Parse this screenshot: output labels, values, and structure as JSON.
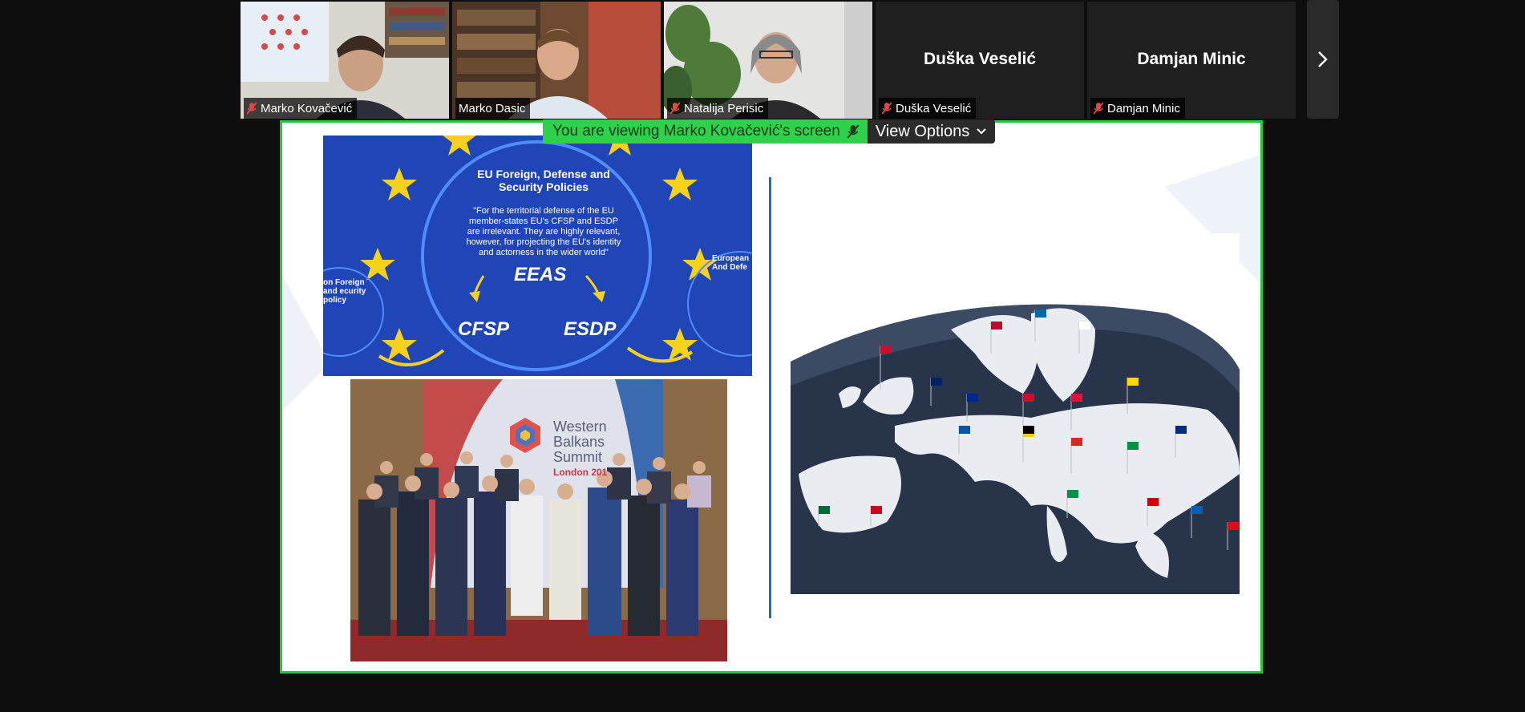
{
  "participants": [
    {
      "name": "Marko Kovačević",
      "muted": true
    },
    {
      "name": "Marko Dasic",
      "muted": false
    },
    {
      "name": "Natalija Perisic",
      "muted": true
    },
    {
      "name": "Duška Veselić",
      "muted": true
    },
    {
      "name": "Damjan Minic",
      "muted": true
    }
  ],
  "banner": {
    "viewing_text": "You are viewing Marko Kovačević's screen",
    "options_label": "View Options"
  },
  "slide": {
    "eu_title": "EU Foreign, Defense and Security Policies",
    "eu_quote": "\"For the territorial defense of the EU member-states EU's CFSP and ESDP are irrelevant. They are highly relevant, however, for projecting the EU's identity and actorness in the wider world\"",
    "eeas": "EEAS",
    "cfsp": "CFSP",
    "esdp": "ESDP",
    "left_side": "on Foreign and ecurity policy",
    "right_side": "European And Defe",
    "summit_line1": "Western",
    "summit_line2": "Balkans",
    "summit_line3": "Summit",
    "summit_sub": "London 201"
  },
  "colors": {
    "share_border": "#25c53c",
    "banner_green": "#2fd04b",
    "eu_blue": "#1f45b7",
    "star_yellow": "#f6d11c"
  }
}
